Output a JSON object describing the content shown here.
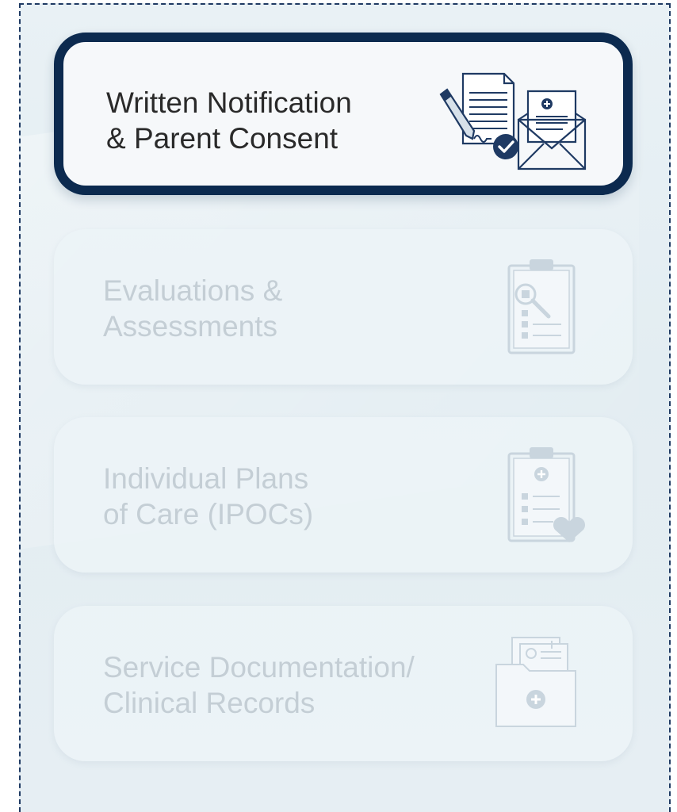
{
  "menu": {
    "items": [
      {
        "label": "Written Notification\n& Parent Consent",
        "state": "active",
        "icon": "document-envelope-icon"
      },
      {
        "label": "Evaluations &\nAssessments",
        "state": "inactive",
        "icon": "clipboard-magnifier-icon"
      },
      {
        "label": "Individual Plans\nof Care (IPOCs)",
        "state": "inactive",
        "icon": "clipboard-heart-icon"
      },
      {
        "label": "Service Documentation/\nClinical Records",
        "state": "inactive",
        "icon": "folder-plus-icon"
      }
    ]
  },
  "colors": {
    "active_border": "#0c2a4f",
    "active_text": "#2a2a2a",
    "inactive_text": "#c4ced5",
    "icon_accent": "#1f3a63"
  }
}
